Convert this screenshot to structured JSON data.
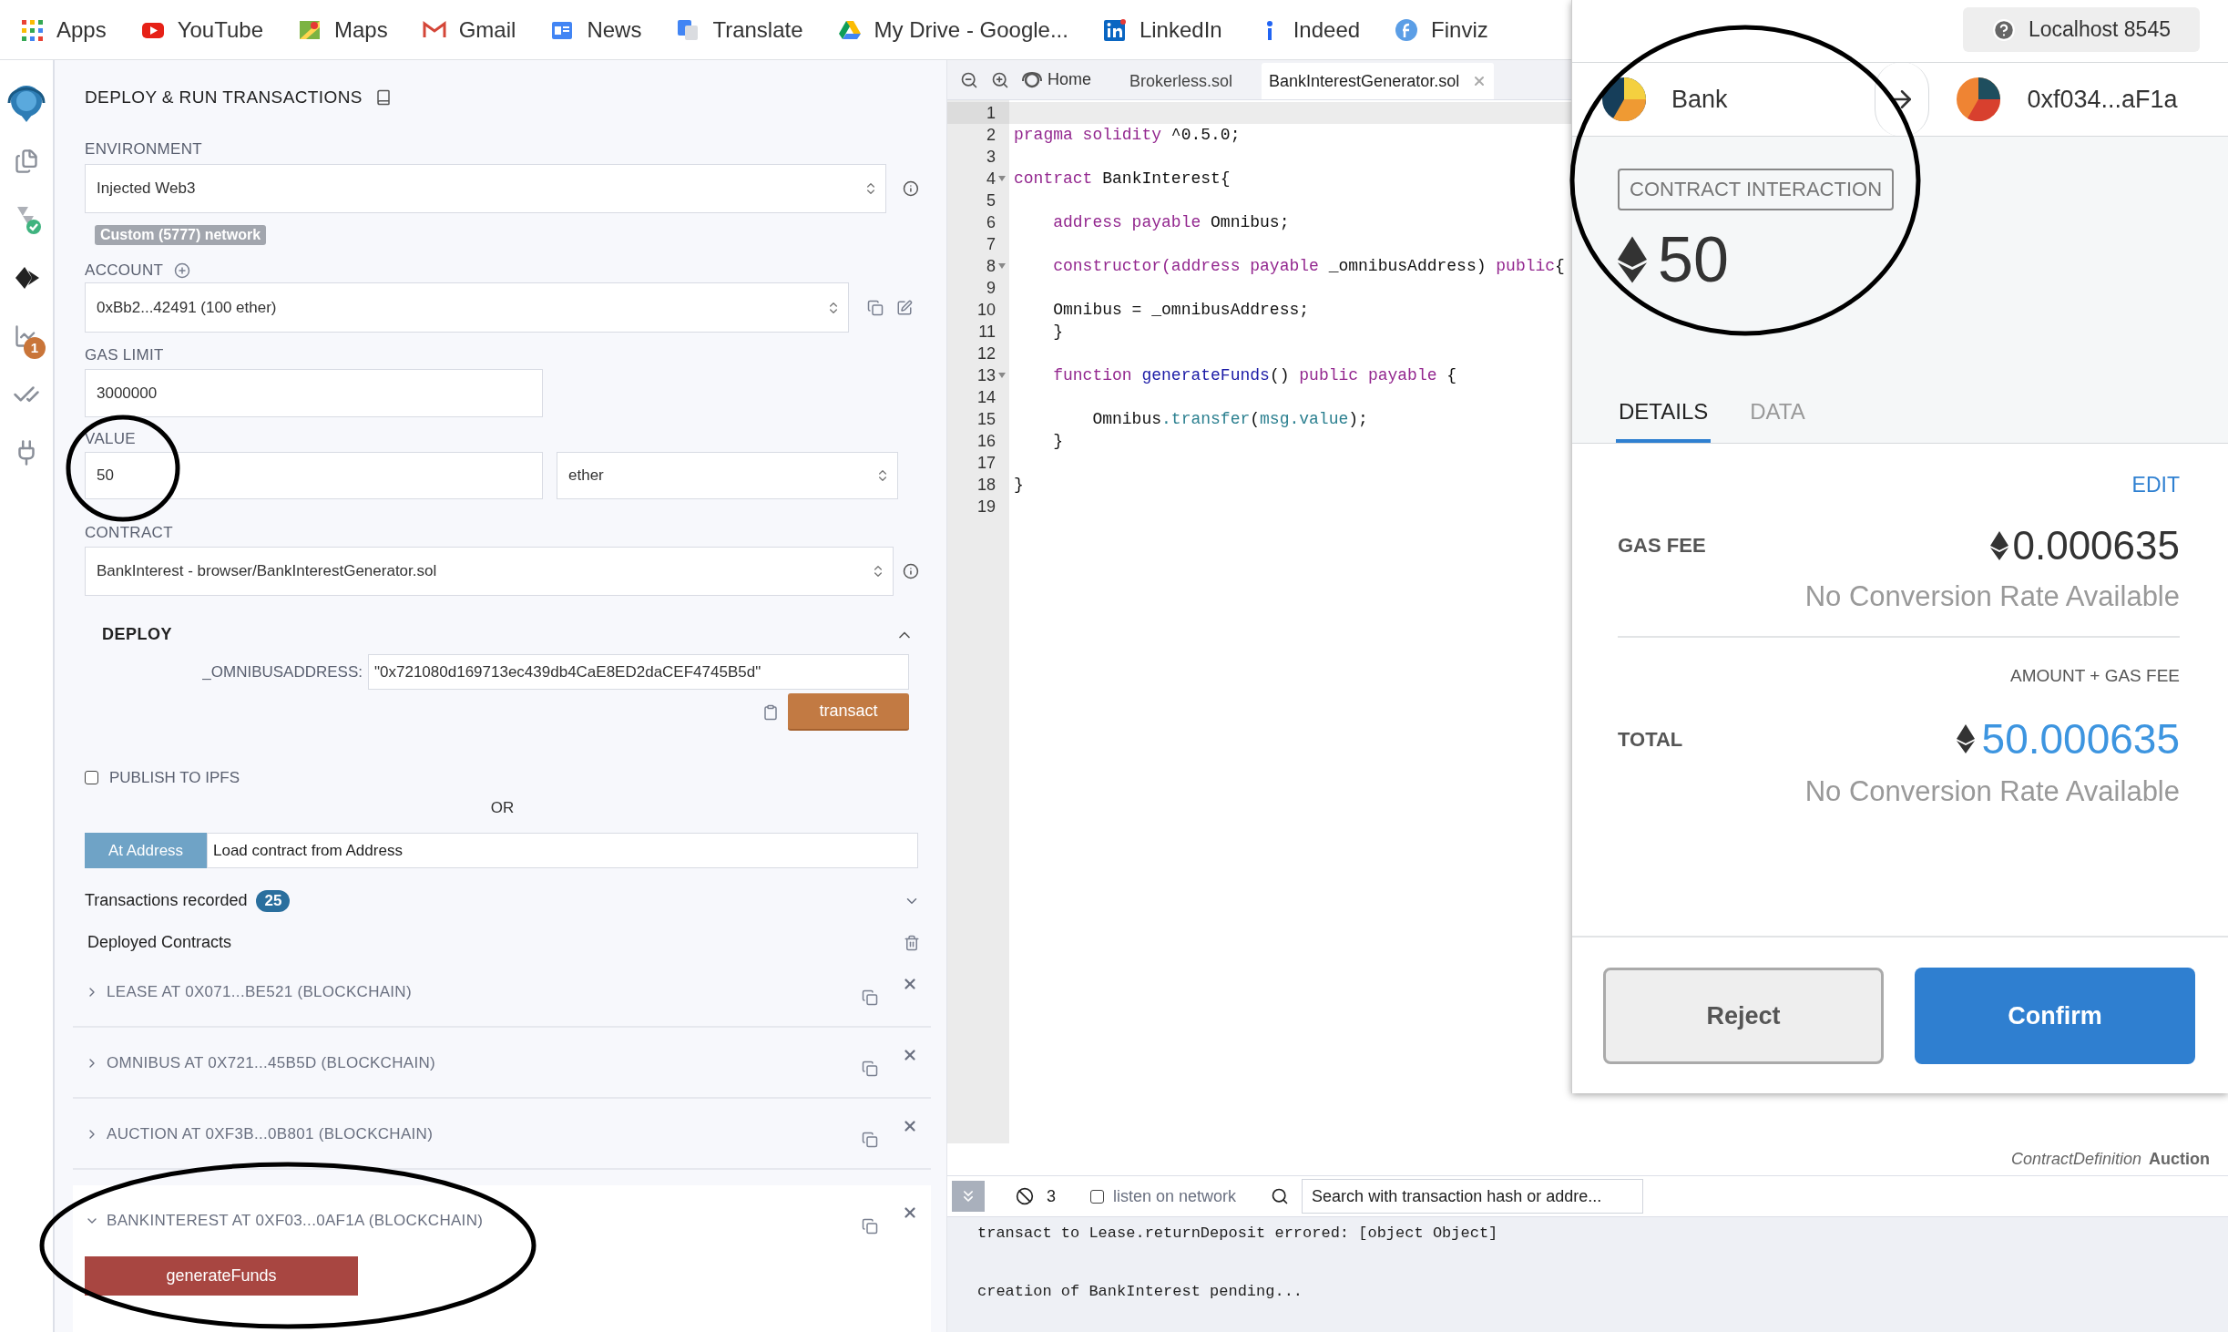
{
  "bookmarks": [
    {
      "kind": "apps",
      "label": "Apps"
    },
    {
      "kind": "video",
      "label": "YouTube"
    },
    {
      "kind": "maps",
      "label": "Maps"
    },
    {
      "kind": "mail",
      "label": "Gmail"
    },
    {
      "kind": "news",
      "label": "News"
    },
    {
      "kind": "translate",
      "label": "Translate"
    },
    {
      "kind": "drive",
      "label": "My Drive - Google..."
    },
    {
      "kind": "linkedin",
      "label": "LinkedIn"
    },
    {
      "kind": "indeed",
      "label": "Indeed"
    },
    {
      "kind": "finviz",
      "label": "Finviz"
    }
  ],
  "sidebar": {
    "items": [
      {
        "kind": "logo",
        "selected": false
      },
      {
        "kind": "files",
        "selected": false
      },
      {
        "kind": "compiler",
        "selected": false
      },
      {
        "kind": "deploy",
        "selected": true
      },
      {
        "kind": "analysis",
        "selected": false,
        "badge": "1"
      },
      {
        "kind": "tests",
        "selected": false
      },
      {
        "kind": "plugins",
        "selected": false
      }
    ]
  },
  "panel": {
    "title": "DEPLOY & RUN TRANSACTIONS",
    "environment": {
      "label": "ENVIRONMENT",
      "value": "Injected Web3"
    },
    "network_badge": "Custom (5777) network",
    "account": {
      "label": "ACCOUNT",
      "value": "0xBb2...42491 (100 ether)"
    },
    "gas_limit": {
      "label": "GAS LIMIT",
      "value": "3000000"
    },
    "value": {
      "label": "VALUE",
      "value": "50",
      "unit": "ether"
    },
    "contract": {
      "label": "CONTRACT",
      "value": "BankInterest - browser/BankInterestGenerator.sol"
    },
    "deploy": {
      "title": "DEPLOY",
      "expanded": true,
      "param_label": "_OMNIBUSADDRESS:",
      "param_value": "\"0x721080d169713ec439db4CaE8ED2daCEF4745B5d\"",
      "button": "transact"
    },
    "publish": {
      "label": "PUBLISH TO IPFS",
      "checked": false
    },
    "or": "OR",
    "at_address": {
      "button": "At Address",
      "placeholder": "Load contract from Address"
    },
    "transactions": {
      "label": "Transactions recorded",
      "count": "25",
      "expanded": false
    },
    "deployed": {
      "title": "Deployed Contracts",
      "items": [
        {
          "label": "LEASE AT 0X071...BE521 (BLOCKCHAIN)",
          "expanded": false
        },
        {
          "label": "OMNIBUS AT 0X721...45B5D (BLOCKCHAIN)",
          "expanded": false
        },
        {
          "label": "AUCTION AT 0XF3B...0B801 (BLOCKCHAIN)",
          "expanded": false
        },
        {
          "label": "BANKINTEREST AT 0XF03...0AF1A (BLOCKCHAIN)",
          "expanded": true,
          "functions": [
            {
              "label": "generateFunds",
              "kind": "payable"
            }
          ]
        }
      ]
    }
  },
  "editor": {
    "home_label": "Home",
    "tabs": [
      {
        "label": "Brokerless.sol",
        "selected": false
      },
      {
        "label": "BankInterestGenerator.sol",
        "selected": true
      }
    ],
    "lines": [
      {
        "number": "1",
        "foldable": false
      },
      {
        "number": "2",
        "foldable": false,
        "tokens": [
          {
            "kind": "keyword",
            "text": "pragma solidity"
          },
          {
            "kind": "plain",
            "text": " ^0.5.0;"
          }
        ]
      },
      {
        "number": "3",
        "foldable": false
      },
      {
        "number": "4",
        "foldable": true,
        "tokens": [
          {
            "kind": "keyword",
            "text": "contract"
          },
          {
            "kind": "plain",
            "text": " BankInterest{"
          }
        ]
      },
      {
        "number": "5",
        "foldable": false
      },
      {
        "number": "6",
        "foldable": false,
        "tokens": [
          {
            "kind": "keyword",
            "text": "    address payable"
          },
          {
            "kind": "plain",
            "text": " Omnibus;"
          }
        ]
      },
      {
        "number": "7",
        "foldable": false
      },
      {
        "number": "8",
        "foldable": true,
        "tokens": [
          {
            "kind": "keyword",
            "text": "    constructor(address payable"
          },
          {
            "kind": "plain",
            "text": " _omnibusAddress) "
          },
          {
            "kind": "keyword",
            "text": "public"
          },
          {
            "kind": "plain",
            "text": "{"
          }
        ]
      },
      {
        "number": "9",
        "foldable": false
      },
      {
        "number": "10",
        "foldable": false,
        "tokens": [
          {
            "kind": "plain",
            "text": "    Omnibus = _omnibusAddress;"
          }
        ]
      },
      {
        "number": "11",
        "foldable": false,
        "tokens": [
          {
            "kind": "plain",
            "text": "    }"
          }
        ]
      },
      {
        "number": "12",
        "foldable": false
      },
      {
        "number": "13",
        "foldable": true,
        "tokens": [
          {
            "kind": "keyword",
            "text": "    function "
          },
          {
            "kind": "function",
            "text": "generateFunds"
          },
          {
            "kind": "plain",
            "text": "() "
          },
          {
            "kind": "keyword",
            "text": "public payable"
          },
          {
            "kind": "plain",
            "text": " {"
          }
        ]
      },
      {
        "number": "14",
        "foldable": false
      },
      {
        "number": "15",
        "foldable": false,
        "tokens": [
          {
            "kind": "plain",
            "text": "        Omnibus"
          },
          {
            "kind": "member",
            "text": ".transfer"
          },
          {
            "kind": "plain",
            "text": "("
          },
          {
            "kind": "member",
            "text": "msg.value"
          },
          {
            "kind": "plain",
            "text": ");"
          }
        ]
      },
      {
        "number": "16",
        "foldable": false,
        "tokens": [
          {
            "kind": "plain",
            "text": "    }"
          }
        ]
      },
      {
        "number": "17",
        "foldable": false
      },
      {
        "number": "18",
        "foldable": false,
        "tokens": [
          {
            "kind": "plain",
            "text": "}"
          }
        ]
      },
      {
        "number": "19",
        "foldable": false
      }
    ]
  },
  "status_hint": {
    "label": "ContractDefinition",
    "name": "Auction"
  },
  "terminal": {
    "count": "3",
    "listen": {
      "label": "listen on network",
      "checked": false
    },
    "search": {
      "placeholder": "Search with transaction hash or addre..."
    },
    "logs": [
      "transact to Lease.returnDeposit errored: [object Object]",
      "creation of BankInterest pending..."
    ]
  },
  "metamask": {
    "network": "Localhost 8545",
    "from": "Bank",
    "to": "0xf034...aF1a",
    "type_label": "CONTRACT INTERACTION",
    "amount": "50",
    "tabs": [
      {
        "label": "DETAILS",
        "selected": true
      },
      {
        "label": "DATA",
        "selected": false
      }
    ],
    "edit": "EDIT",
    "gas_fee": {
      "label": "GAS FEE",
      "value": "0.000635",
      "conversion": "No Conversion Rate Available"
    },
    "total": {
      "caption": "AMOUNT + GAS FEE",
      "label": "TOTAL",
      "value": "50.000635",
      "conversion": "No Conversion Rate Available"
    },
    "buttons": [
      {
        "label": "Reject",
        "kind": "secondary"
      },
      {
        "label": "Confirm",
        "kind": "primary"
      }
    ]
  }
}
